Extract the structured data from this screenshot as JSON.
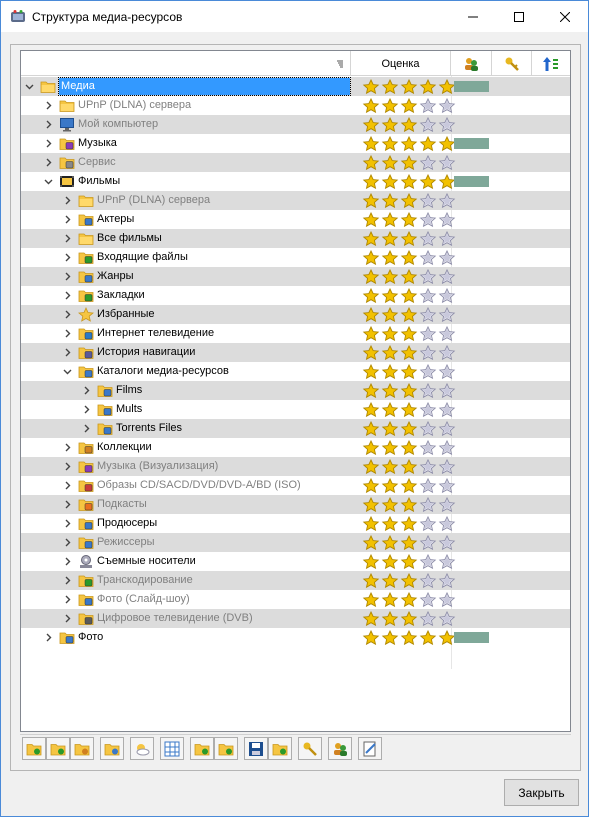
{
  "window": {
    "title": "Структура медиа-ресурсов",
    "minimize_icon": "minimize-icon",
    "maximize_icon": "maximize-icon",
    "close_icon": "close-icon"
  },
  "grid": {
    "columns": [
      {
        "label": "",
        "icon": "sort-icon"
      },
      {
        "label": "Оценка",
        "icon": ""
      },
      {
        "label": "",
        "icon": "people-icon"
      },
      {
        "label": "",
        "icon": "key-icon"
      },
      {
        "label": "",
        "icon": "sort-order-icon"
      }
    ],
    "rows": [
      {
        "label": "Медиа",
        "level": 0,
        "expander": "expanded",
        "icon": "folder-open-icon",
        "rating": 5,
        "bar": true,
        "alt": true,
        "dim": false,
        "selected": true
      },
      {
        "label": "UPnP (DLNA) сервера",
        "level": 1,
        "expander": "collapsed",
        "icon": "folder-icon",
        "rating": 3,
        "bar": false,
        "alt": false,
        "dim": true,
        "selected": false
      },
      {
        "label": "Мой компьютер",
        "level": 1,
        "expander": "collapsed",
        "icon": "computer-icon",
        "rating": 3,
        "bar": false,
        "alt": true,
        "dim": true,
        "selected": false
      },
      {
        "label": "Музыка",
        "level": 1,
        "expander": "collapsed",
        "icon": "music-icon",
        "rating": 5,
        "bar": true,
        "alt": false,
        "dim": false,
        "selected": false
      },
      {
        "label": "Сервис",
        "level": 1,
        "expander": "collapsed",
        "icon": "service-icon",
        "rating": 3,
        "bar": false,
        "alt": true,
        "dim": true,
        "selected": false
      },
      {
        "label": "Фильмы",
        "level": 1,
        "expander": "expanded",
        "icon": "film-icon",
        "rating": 5,
        "bar": true,
        "alt": false,
        "dim": false,
        "selected": false
      },
      {
        "label": "UPnP (DLNA) сервера",
        "level": 2,
        "expander": "collapsed",
        "icon": "folder-icon",
        "rating": 3,
        "bar": false,
        "alt": true,
        "dim": true,
        "selected": false
      },
      {
        "label": "Актеры",
        "level": 2,
        "expander": "collapsed",
        "icon": "actors-icon",
        "rating": 3,
        "bar": false,
        "alt": false,
        "dim": false,
        "selected": false
      },
      {
        "label": "Все фильмы",
        "level": 2,
        "expander": "collapsed",
        "icon": "folder-icon",
        "rating": 3,
        "bar": false,
        "alt": true,
        "dim": false,
        "selected": false
      },
      {
        "label": "Входящие файлы",
        "level": 2,
        "expander": "collapsed",
        "icon": "incoming-icon",
        "rating": 3,
        "bar": false,
        "alt": false,
        "dim": false,
        "selected": false
      },
      {
        "label": "Жанры",
        "level": 2,
        "expander": "collapsed",
        "icon": "genres-icon",
        "rating": 3,
        "bar": false,
        "alt": true,
        "dim": false,
        "selected": false
      },
      {
        "label": "Закладки",
        "level": 2,
        "expander": "collapsed",
        "icon": "bookmarks-icon",
        "rating": 3,
        "bar": false,
        "alt": false,
        "dim": false,
        "selected": false
      },
      {
        "label": "Избранные",
        "level": 2,
        "expander": "collapsed",
        "icon": "favorites-icon",
        "rating": 3,
        "bar": false,
        "alt": true,
        "dim": false,
        "selected": false
      },
      {
        "label": "Интернет телевидение",
        "level": 2,
        "expander": "collapsed",
        "icon": "internet-tv-icon",
        "rating": 3,
        "bar": false,
        "alt": false,
        "dim": false,
        "selected": false
      },
      {
        "label": "История навигации",
        "level": 2,
        "expander": "collapsed",
        "icon": "history-icon",
        "rating": 3,
        "bar": false,
        "alt": true,
        "dim": false,
        "selected": false
      },
      {
        "label": "Каталоги медиа-ресурсов",
        "level": 2,
        "expander": "expanded",
        "icon": "catalog-icon",
        "rating": 3,
        "bar": false,
        "alt": false,
        "dim": false,
        "selected": false
      },
      {
        "label": "Films",
        "level": 3,
        "expander": "collapsed",
        "icon": "catalog-icon",
        "rating": 3,
        "bar": false,
        "alt": true,
        "dim": false,
        "selected": false
      },
      {
        "label": "Mults",
        "level": 3,
        "expander": "collapsed",
        "icon": "catalog-icon",
        "rating": 3,
        "bar": false,
        "alt": false,
        "dim": false,
        "selected": false
      },
      {
        "label": "Torrents Files",
        "level": 3,
        "expander": "collapsed",
        "icon": "catalog-icon",
        "rating": 3,
        "bar": false,
        "alt": true,
        "dim": false,
        "selected": false
      },
      {
        "label": "Коллекции",
        "level": 2,
        "expander": "collapsed",
        "icon": "collections-icon",
        "rating": 3,
        "bar": false,
        "alt": false,
        "dim": false,
        "selected": false
      },
      {
        "label": "Музыка (Визуализация)",
        "level": 2,
        "expander": "collapsed",
        "icon": "music-visual-icon",
        "rating": 3,
        "bar": false,
        "alt": true,
        "dim": true,
        "selected": false
      },
      {
        "label": "Образы CD/SACD/DVD/DVD-A/BD (ISO)",
        "level": 2,
        "expander": "collapsed",
        "icon": "disc-image-icon",
        "rating": 3,
        "bar": false,
        "alt": false,
        "dim": true,
        "selected": false
      },
      {
        "label": "Подкасты",
        "level": 2,
        "expander": "collapsed",
        "icon": "podcast-icon",
        "rating": 3,
        "bar": false,
        "alt": true,
        "dim": true,
        "selected": false
      },
      {
        "label": "Продюсеры",
        "level": 2,
        "expander": "collapsed",
        "icon": "producers-icon",
        "rating": 3,
        "bar": false,
        "alt": false,
        "dim": false,
        "selected": false
      },
      {
        "label": "Режиссеры",
        "level": 2,
        "expander": "collapsed",
        "icon": "directors-icon",
        "rating": 3,
        "bar": false,
        "alt": true,
        "dim": true,
        "selected": false
      },
      {
        "label": "Съемные носители",
        "level": 2,
        "expander": "collapsed",
        "icon": "removable-media-icon",
        "rating": 3,
        "bar": false,
        "alt": false,
        "dim": false,
        "selected": false
      },
      {
        "label": "Транскодирование",
        "level": 2,
        "expander": "collapsed",
        "icon": "transcode-icon",
        "rating": 3,
        "bar": false,
        "alt": true,
        "dim": true,
        "selected": false
      },
      {
        "label": "Фото (Слайд-шоу)",
        "level": 2,
        "expander": "collapsed",
        "icon": "slideshow-icon",
        "rating": 3,
        "bar": false,
        "alt": false,
        "dim": true,
        "selected": false
      },
      {
        "label": "Цифровое телевидение (DVB)",
        "level": 2,
        "expander": "collapsed",
        "icon": "dvb-icon",
        "rating": 3,
        "bar": false,
        "alt": true,
        "dim": true,
        "selected": false
      },
      {
        "label": "Фото",
        "level": 1,
        "expander": "collapsed",
        "icon": "photo-icon",
        "rating": 5,
        "bar": true,
        "alt": false,
        "dim": false,
        "selected": false
      }
    ]
  },
  "toolbar": {
    "buttons": [
      "add-group-icon",
      "add-folder-icon",
      "edit-folder-icon",
      "open-folder-icon",
      "weather-icon",
      "grid-icon",
      "folder-up-icon",
      "folder-down-icon",
      "save-icon",
      "export-icon",
      "key-icon",
      "people-icon",
      "edit-icon"
    ]
  },
  "footer": {
    "close_label": "Закрыть"
  },
  "colors": {
    "selection": "#3399ff",
    "alt_row": "#dcdcdc",
    "bar": "#7fa899",
    "star_gold": "#f2c100",
    "star_empty": "#c8c8dc"
  }
}
